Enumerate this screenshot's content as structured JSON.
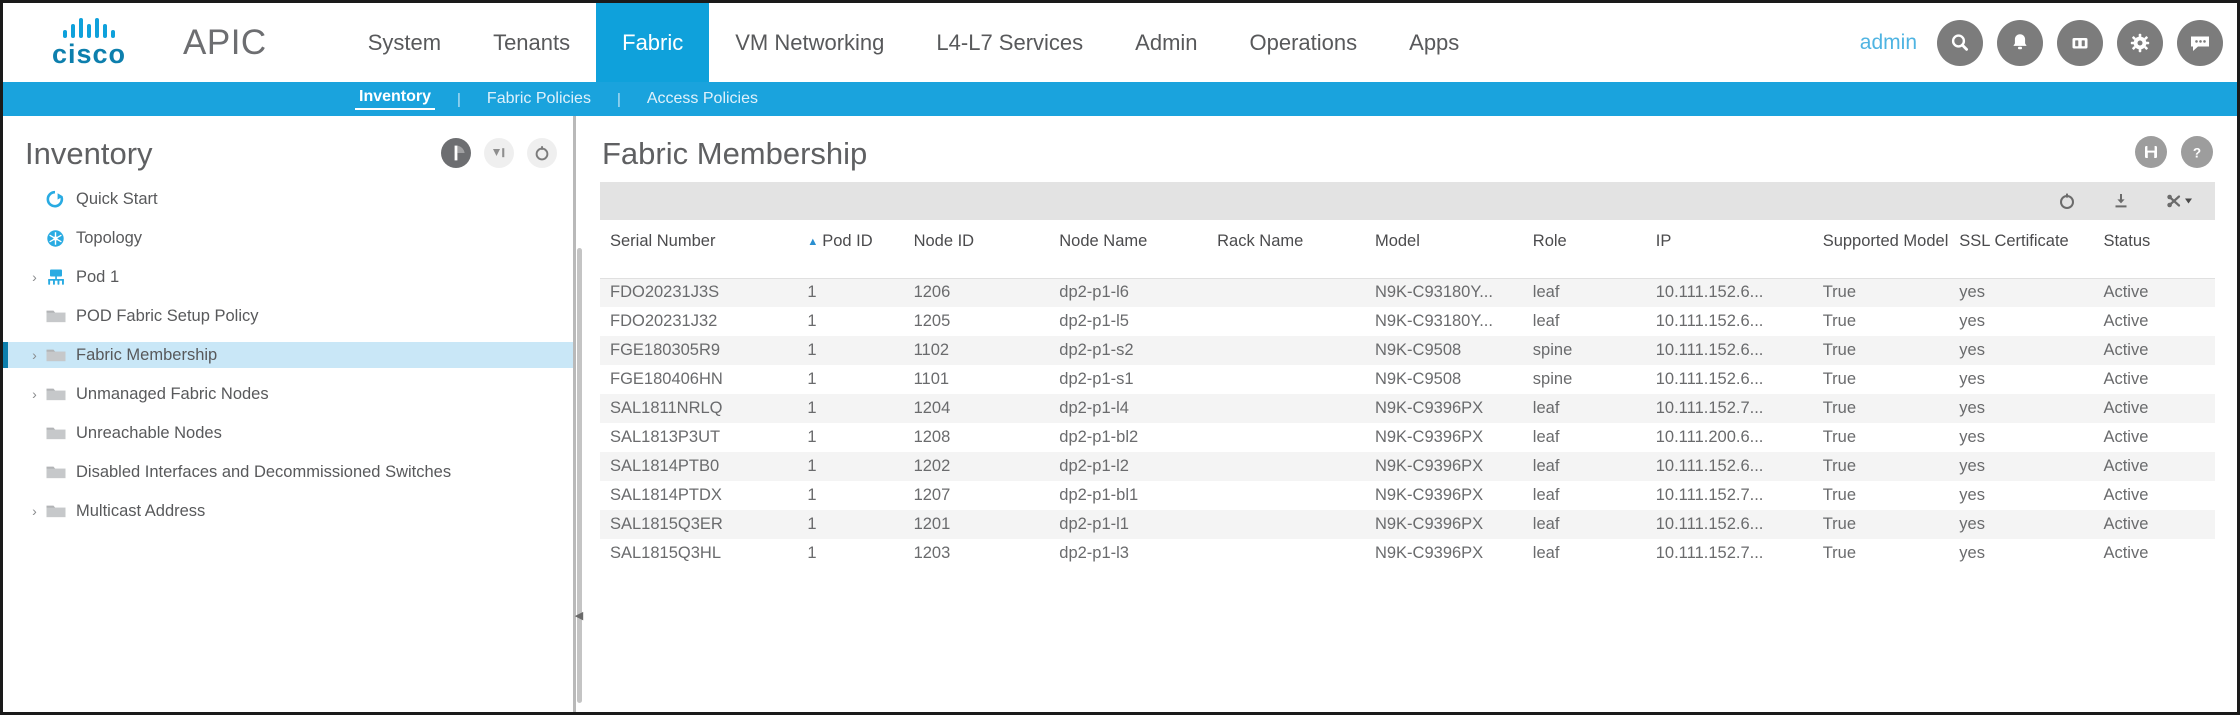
{
  "header": {
    "brand": "cisco",
    "product": "APIC",
    "nav": [
      {
        "label": "System",
        "active": false
      },
      {
        "label": "Tenants",
        "active": false
      },
      {
        "label": "Fabric",
        "active": true
      },
      {
        "label": "VM Networking",
        "active": false
      },
      {
        "label": "L4-L7 Services",
        "active": false
      },
      {
        "label": "Admin",
        "active": false
      },
      {
        "label": "Operations",
        "active": false
      },
      {
        "label": "Apps",
        "active": false
      }
    ],
    "user": "admin",
    "icons": [
      "search-icon",
      "bell-icon",
      "tasks-icon",
      "gear-icon",
      "feedback-icon"
    ]
  },
  "subnav": {
    "items": [
      {
        "label": "Inventory",
        "active": true
      },
      {
        "label": "Fabric Policies",
        "active": false
      },
      {
        "label": "Access Policies",
        "active": false
      }
    ],
    "separator": "|"
  },
  "sidebar": {
    "title": "Inventory",
    "header_icons": [
      "panel-toggle-icon",
      "collapse-panel-icon",
      "refresh-icon"
    ],
    "items": [
      {
        "label": "Quick Start",
        "icon": "quick-start-icon",
        "expandable": false,
        "indent": 1,
        "selected": false
      },
      {
        "label": "Topology",
        "icon": "topology-icon",
        "expandable": false,
        "indent": 1,
        "selected": false
      },
      {
        "label": "Pod 1",
        "icon": "pod-icon",
        "expandable": true,
        "indent": 1,
        "selected": false
      },
      {
        "label": "POD Fabric Setup Policy",
        "icon": "folder-icon",
        "expandable": false,
        "indent": 1,
        "selected": false
      },
      {
        "label": "Fabric Membership",
        "icon": "folder-icon",
        "expandable": true,
        "indent": 1,
        "selected": true
      },
      {
        "label": "Unmanaged Fabric Nodes",
        "icon": "folder-icon",
        "expandable": true,
        "indent": 1,
        "selected": false
      },
      {
        "label": "Unreachable Nodes",
        "icon": "folder-icon",
        "expandable": false,
        "indent": 1,
        "selected": false
      },
      {
        "label": "Disabled Interfaces and Decommissioned Switches",
        "icon": "folder-icon",
        "expandable": false,
        "indent": 1,
        "selected": false
      },
      {
        "label": "Multicast Address",
        "icon": "folder-icon",
        "expandable": true,
        "indent": 1,
        "selected": false
      }
    ]
  },
  "main": {
    "title": "Fabric Membership",
    "header_icons": [
      "save-icon",
      "help-icon"
    ],
    "toolbar_icons": [
      "refresh-icon",
      "download-icon",
      "actions-icon"
    ],
    "table": {
      "columns": [
        {
          "label": "Serial Number",
          "sorted": false,
          "cls": "col-serial"
        },
        {
          "label": "Pod ID",
          "sorted": true,
          "sort_dir": "asc",
          "cls": "col-pod"
        },
        {
          "label": "Node ID",
          "sorted": false,
          "cls": "col-nodeid"
        },
        {
          "label": "Node Name",
          "sorted": false,
          "cls": "col-nodename"
        },
        {
          "label": "Rack Name",
          "sorted": false,
          "cls": "col-rack"
        },
        {
          "label": "Model",
          "sorted": false,
          "cls": "col-model"
        },
        {
          "label": "Role",
          "sorted": false,
          "cls": "col-role"
        },
        {
          "label": "IP",
          "sorted": false,
          "cls": "col-ip"
        },
        {
          "label": "Supported Model",
          "sorted": false,
          "cls": "col-supp"
        },
        {
          "label": "SSL Certificate",
          "sorted": false,
          "cls": "col-ssl"
        },
        {
          "label": "Status",
          "sorted": false,
          "cls": "col-status"
        }
      ],
      "rows": [
        {
          "serial": "FDO20231J3S",
          "pod_id": "1",
          "node_id": "1206",
          "node_name": "dp2-p1-l6",
          "rack_name": "",
          "model": "N9K-C93180Y...",
          "role": "leaf",
          "ip": "10.111.152.6...",
          "supported_model": "True",
          "ssl_certificate": "yes",
          "status": "Active"
        },
        {
          "serial": "FDO20231J32",
          "pod_id": "1",
          "node_id": "1205",
          "node_name": "dp2-p1-l5",
          "rack_name": "",
          "model": "N9K-C93180Y...",
          "role": "leaf",
          "ip": "10.111.152.6...",
          "supported_model": "True",
          "ssl_certificate": "yes",
          "status": "Active"
        },
        {
          "serial": "FGE180305R9",
          "pod_id": "1",
          "node_id": "1102",
          "node_name": "dp2-p1-s2",
          "rack_name": "",
          "model": "N9K-C9508",
          "role": "spine",
          "ip": "10.111.152.6...",
          "supported_model": "True",
          "ssl_certificate": "yes",
          "status": "Active"
        },
        {
          "serial": "FGE180406HN",
          "pod_id": "1",
          "node_id": "1101",
          "node_name": "dp2-p1-s1",
          "rack_name": "",
          "model": "N9K-C9508",
          "role": "spine",
          "ip": "10.111.152.6...",
          "supported_model": "True",
          "ssl_certificate": "yes",
          "status": "Active"
        },
        {
          "serial": "SAL1811NRLQ",
          "pod_id": "1",
          "node_id": "1204",
          "node_name": "dp2-p1-l4",
          "rack_name": "",
          "model": "N9K-C9396PX",
          "role": "leaf",
          "ip": "10.111.152.7...",
          "supported_model": "True",
          "ssl_certificate": "yes",
          "status": "Active"
        },
        {
          "serial": "SAL1813P3UT",
          "pod_id": "1",
          "node_id": "1208",
          "node_name": "dp2-p1-bl2",
          "rack_name": "",
          "model": "N9K-C9396PX",
          "role": "leaf",
          "ip": "10.111.200.6...",
          "supported_model": "True",
          "ssl_certificate": "yes",
          "status": "Active"
        },
        {
          "serial": "SAL1814PTB0",
          "pod_id": "1",
          "node_id": "1202",
          "node_name": "dp2-p1-l2",
          "rack_name": "",
          "model": "N9K-C9396PX",
          "role": "leaf",
          "ip": "10.111.152.6...",
          "supported_model": "True",
          "ssl_certificate": "yes",
          "status": "Active"
        },
        {
          "serial": "SAL1814PTDX",
          "pod_id": "1",
          "node_id": "1207",
          "node_name": "dp2-p1-bl1",
          "rack_name": "",
          "model": "N9K-C9396PX",
          "role": "leaf",
          "ip": "10.111.152.7...",
          "supported_model": "True",
          "ssl_certificate": "yes",
          "status": "Active"
        },
        {
          "serial": "SAL1815Q3ER",
          "pod_id": "1",
          "node_id": "1201",
          "node_name": "dp2-p1-l1",
          "rack_name": "",
          "model": "N9K-C9396PX",
          "role": "leaf",
          "ip": "10.111.152.6...",
          "supported_model": "True",
          "ssl_certificate": "yes",
          "status": "Active"
        },
        {
          "serial": "SAL1815Q3HL",
          "pod_id": "1",
          "node_id": "1203",
          "node_name": "dp2-p1-l3",
          "rack_name": "",
          "model": "N9K-C9396PX",
          "role": "leaf",
          "ip": "10.111.152.7...",
          "supported_model": "True",
          "ssl_certificate": "yes",
          "status": "Active"
        }
      ]
    }
  },
  "colors": {
    "brand_blue": "#0fa1db",
    "subnav_blue": "#1aa3dd",
    "selection_blue": "#c9e7f7",
    "text_grey": "#58595b"
  }
}
